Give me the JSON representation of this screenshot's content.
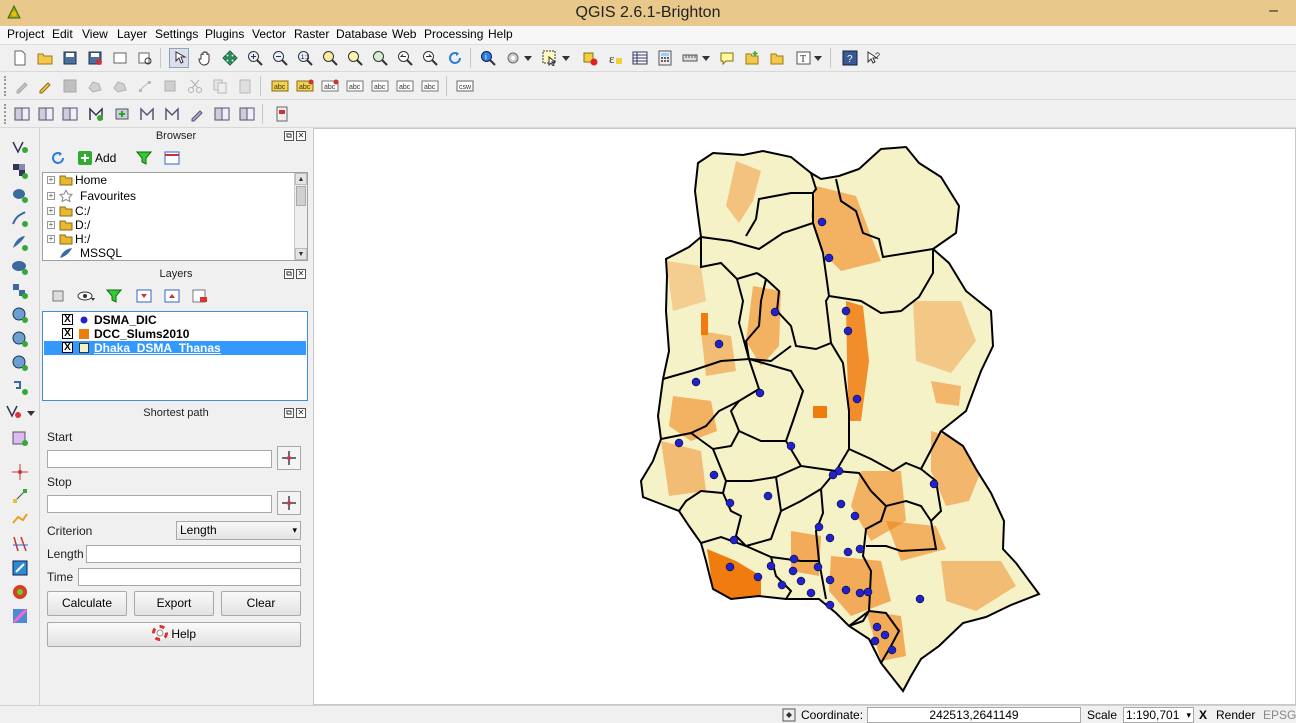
{
  "window": {
    "title": "QGIS 2.6.1-Brighton",
    "minimize_glyph": "–"
  },
  "menu": [
    "Project",
    "Edit",
    "View",
    "Layer",
    "Settings",
    "Plugins",
    "Vector",
    "Raster",
    "Database",
    "Web",
    "Processing",
    "Help"
  ],
  "toolbar2": {
    "csw_label": "csw"
  },
  "browser": {
    "title": "Browser",
    "add_label": "Add",
    "items": [
      "Home",
      "Favourites",
      "C:/",
      "D:/",
      "H:/",
      "MSSQL"
    ]
  },
  "layers": {
    "title": "Layers",
    "items": [
      {
        "name": "DSMA_DIC",
        "symbol_color": "#2222cc",
        "checked": "X"
      },
      {
        "name": "DCC_Slums2010",
        "symbol_color": "#f07b0f",
        "checked": "X"
      },
      {
        "name": "Dhaka_DSMA_Thanas",
        "symbol_color": "#f5f2c8",
        "checked": "X"
      }
    ]
  },
  "shortest_path": {
    "title": "Shortest path",
    "start_label": "Start",
    "start_value": "",
    "stop_label": "Stop",
    "stop_value": "",
    "criterion_label": "Criterion",
    "criterion_value": "Length",
    "length_label": "Length",
    "length_value": "",
    "time_label": "Time",
    "time_value": "",
    "calculate_label": "Calculate",
    "export_label": "Export",
    "clear_label": "Clear",
    "help_label": "Help"
  },
  "status": {
    "coordinate_label": "Coordinate:",
    "coordinate_value": "242513,2641149",
    "scale_label": "Scale",
    "scale_value": "1:190,701",
    "render_label": "Render",
    "render_checked": "X",
    "crs_label": "EPSG:"
  },
  "colors": {
    "polygon_fill": "#f5f2c8",
    "slum_fill": "#f07b0f",
    "point_fill": "#2222cc",
    "title_bg": "#e8c98b"
  }
}
